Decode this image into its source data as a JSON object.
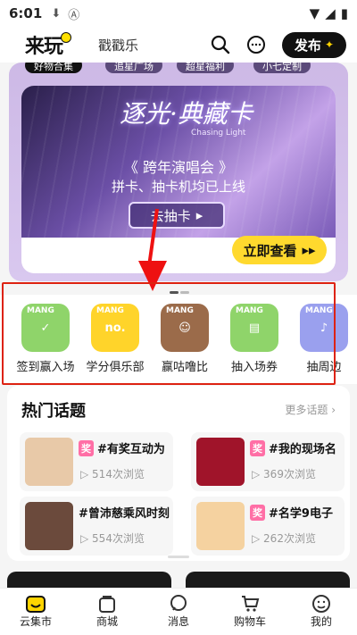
{
  "status": {
    "time": "6:01"
  },
  "header": {
    "logo": "来玩",
    "subtab": "戳戳乐",
    "publish": "发布"
  },
  "top_pills": [
    "好物合集",
    "追星广场",
    "超星福利",
    "小七定制"
  ],
  "banner": {
    "title": "逐光·典藏卡",
    "subtitle_en": "Chasing Light",
    "line1": "《 跨年演唱会 》",
    "line2": "拼卡、抽卡机均已上线",
    "draw_button": "去抽卡",
    "view_button": "立即查看"
  },
  "icon_row": [
    {
      "label": "签到赢入场",
      "mark": "MANG",
      "color": "#8fd46a"
    },
    {
      "label": "学分俱乐部",
      "mark": "MANG",
      "color": "#ffd42a"
    },
    {
      "label": "赢咕噜比",
      "mark": "MANG",
      "color": "#9b6b4a"
    },
    {
      "label": "抽入场券",
      "mark": "MANG",
      "color": "#8fd46a"
    },
    {
      "label": "抽周边",
      "mark": "MANG",
      "color": "#9aa0ee"
    }
  ],
  "hot": {
    "title": "热门话题",
    "more": "更多话题",
    "cards": [
      {
        "title": "#有奖互动为",
        "views": "514次浏览",
        "award": "奖",
        "thumb_color": "#e8c9a8"
      },
      {
        "title": "#我的现场名",
        "views": "369次浏览",
        "award": "奖",
        "thumb_color": "#a0142a"
      },
      {
        "title": "#曾沛慈乘风时刻",
        "views": "554次浏览",
        "award": "",
        "thumb_color": "#6b4a3c"
      },
      {
        "title": "#名学9电子",
        "views": "262次浏览",
        "award": "奖",
        "thumb_color": "#f5d2a0"
      }
    ]
  },
  "nav": [
    {
      "label": "云集市",
      "icon": "store-icon"
    },
    {
      "label": "商城",
      "icon": "bag-icon"
    },
    {
      "label": "消息",
      "icon": "message-icon"
    },
    {
      "label": "购物车",
      "icon": "cart-icon"
    },
    {
      "label": "我的",
      "icon": "profile-icon"
    }
  ]
}
